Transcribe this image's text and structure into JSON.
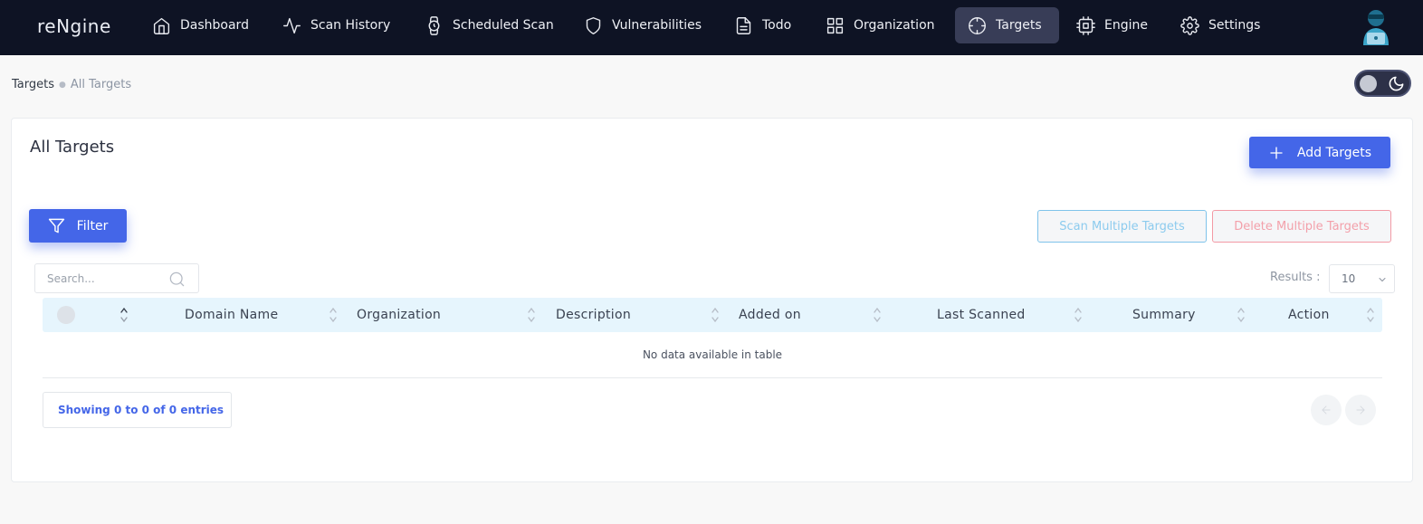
{
  "app": {
    "brand": "reNgine"
  },
  "nav": {
    "items": [
      {
        "label": "Dashboard",
        "icon": "home-icon"
      },
      {
        "label": "Scan History",
        "icon": "activity-icon"
      },
      {
        "label": "Scheduled Scan",
        "icon": "watch-icon"
      },
      {
        "label": "Vulnerabilities",
        "icon": "shield-icon"
      },
      {
        "label": "Todo",
        "icon": "file-text-icon"
      },
      {
        "label": "Organization",
        "icon": "grid-icon"
      },
      {
        "label": "Targets",
        "icon": "crosshair-icon",
        "active": true
      },
      {
        "label": "Engine",
        "icon": "cpu-icon"
      },
      {
        "label": "Settings",
        "icon": "settings-icon"
      }
    ]
  },
  "breadcrumb": {
    "root": "Targets",
    "current": "All Targets"
  },
  "card": {
    "title": "All Targets",
    "add_button": "Add Targets",
    "filter_button": "Filter",
    "scan_multiple_button": "Scan Multiple Targets",
    "delete_multiple_button": "Delete Multiple Targets"
  },
  "search": {
    "placeholder": "Search..."
  },
  "results": {
    "label": "Results :",
    "value": "10"
  },
  "table": {
    "columns": [
      "Domain Name",
      "Organization",
      "Description",
      "Added on",
      "Last Scanned",
      "Summary",
      "Action"
    ],
    "empty_message": "No data available in table",
    "info": "Showing 0 to 0 of 0 entries"
  },
  "colors": {
    "nav_bg": "#0e1324",
    "nav_active": "#383d57",
    "primary": "#4466e8",
    "info_outline": "#7fc3ea",
    "danger_outline": "#f39aa5",
    "table_header_bg": "#e6f5fd"
  }
}
